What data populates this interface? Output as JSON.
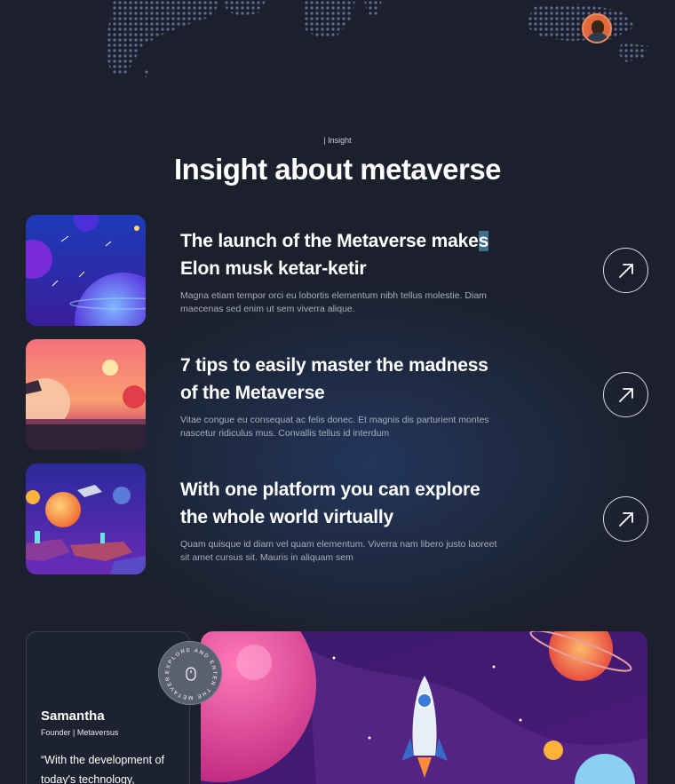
{
  "section": {
    "tag": "| Insight",
    "title": "Insight about metaverse"
  },
  "articles": [
    {
      "title_before": "The launch of the Metaverse make",
      "title_selected": "s",
      "title_after": " Elon musk ketar-ketir",
      "description": "Magna etiam tempor orci eu lobortis elementum nibh tellus molestie. Diam maecenas sed enim ut sem viverra alique.",
      "thumbnail_icon": "space-planets-thumbnail",
      "button_icon": "arrow-up-right-icon"
    },
    {
      "title": "7 tips to easily master the madness of the Metaverse",
      "description": "Vitae congue eu consequat ac felis donec. Et magnis dis parturient montes nascetur ridiculus mus. Convallis tellus id interdum",
      "thumbnail_icon": "sunset-planet-thumbnail",
      "button_icon": "arrow-up-right-icon"
    },
    {
      "title": "With one platform you can explore the whole world virtually",
      "description": "Quam quisque id diam vel quam elementum. Viverra nam libero justo laoreet sit amet cursus sit. Mauris in aliquam sem",
      "thumbnail_icon": "floating-islands-thumbnail",
      "button_icon": "arrow-up-right-icon"
    }
  ],
  "testimonial": {
    "name": "Samantha",
    "role": "Founder | Metaversus",
    "quote": "“With the development of today's technology,"
  },
  "badge": {
    "circular_text": "EXPLORE AND ENTER THE METAVERSE",
    "icon": "mouse-scroll-icon"
  },
  "colors": {
    "background": "#1b202c",
    "accent_blue": "#3f6f8a",
    "text_muted": "#a8aeba"
  }
}
